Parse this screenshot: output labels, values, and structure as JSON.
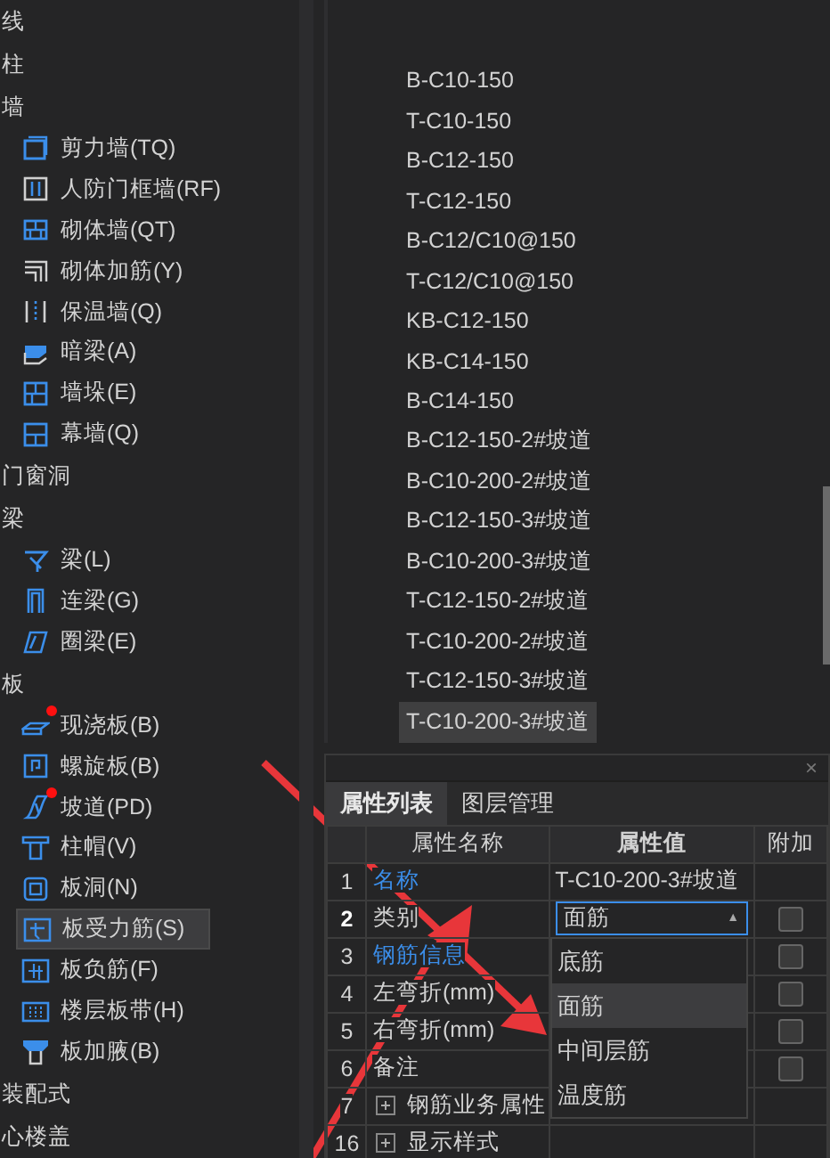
{
  "sidebar": {
    "groups": [
      {
        "label": "线"
      },
      {
        "label": "柱"
      },
      {
        "label": "墙",
        "items": [
          {
            "label": "剪力墙(TQ)",
            "selected": false,
            "badge": false
          },
          {
            "label": "人防门框墙(RF)",
            "selected": false,
            "badge": false
          },
          {
            "label": "砌体墙(QT)",
            "selected": false,
            "badge": false
          },
          {
            "label": "砌体加筋(Y)",
            "selected": false,
            "badge": false
          },
          {
            "label": "保温墙(Q)",
            "selected": false,
            "badge": false
          },
          {
            "label": "暗梁(A)",
            "selected": false,
            "badge": false
          },
          {
            "label": "墙垛(E)",
            "selected": false,
            "badge": false
          },
          {
            "label": "幕墙(Q)",
            "selected": false,
            "badge": false
          }
        ]
      },
      {
        "label": "门窗洞"
      },
      {
        "label": "梁",
        "items": [
          {
            "label": "梁(L)",
            "selected": false,
            "badge": false
          },
          {
            "label": "连梁(G)",
            "selected": false,
            "badge": false
          },
          {
            "label": "圈梁(E)",
            "selected": false,
            "badge": false
          }
        ]
      },
      {
        "label": "板",
        "items": [
          {
            "label": "现浇板(B)",
            "selected": false,
            "badge": true
          },
          {
            "label": "螺旋板(B)",
            "selected": false,
            "badge": false
          },
          {
            "label": "坡道(PD)",
            "selected": false,
            "badge": true
          },
          {
            "label": "柱帽(V)",
            "selected": false,
            "badge": false
          },
          {
            "label": "板洞(N)",
            "selected": false,
            "badge": false
          },
          {
            "label": "板受力筋(S)",
            "selected": true,
            "badge": false
          },
          {
            "label": "板负筋(F)",
            "selected": false,
            "badge": false
          },
          {
            "label": "楼层板带(H)",
            "selected": false,
            "badge": false
          },
          {
            "label": "板加腋(B)",
            "selected": false,
            "badge": false
          }
        ]
      },
      {
        "label": "装配式"
      },
      {
        "label": "心楼盖"
      }
    ]
  },
  "component_list": {
    "items": [
      {
        "label": "B-C10-150",
        "selected": false
      },
      {
        "label": "T-C10-150",
        "selected": false
      },
      {
        "label": "B-C12-150",
        "selected": false
      },
      {
        "label": "T-C12-150",
        "selected": false
      },
      {
        "label": "B-C12/C10@150",
        "selected": false
      },
      {
        "label": "T-C12/C10@150",
        "selected": false
      },
      {
        "label": "KB-C12-150",
        "selected": false
      },
      {
        "label": "KB-C14-150",
        "selected": false
      },
      {
        "label": "B-C14-150",
        "selected": false
      },
      {
        "label": "B-C12-150-2#坡道",
        "selected": false
      },
      {
        "label": "B-C10-200-2#坡道",
        "selected": false
      },
      {
        "label": "B-C12-150-3#坡道",
        "selected": false
      },
      {
        "label": "B-C10-200-3#坡道",
        "selected": false
      },
      {
        "label": "T-C12-150-2#坡道",
        "selected": false
      },
      {
        "label": "T-C10-200-2#坡道",
        "selected": false
      },
      {
        "label": "T-C12-150-3#坡道",
        "selected": false
      },
      {
        "label": "T-C10-200-3#坡道",
        "selected": true
      }
    ]
  },
  "properties": {
    "close": "×",
    "tabs": [
      {
        "label": "属性列表",
        "selected": true
      },
      {
        "label": "图层管理",
        "selected": false
      }
    ],
    "columns": [
      "属性名称",
      "属性值",
      "附加"
    ],
    "rows": [
      {
        "index": "1",
        "name": "名称",
        "kind": "link",
        "value": "T-C10-200-3#坡道",
        "current": false,
        "expandable": false
      },
      {
        "index": "2",
        "name": "类别",
        "kind": "plain",
        "value": "面筋",
        "current": true,
        "checked": false,
        "expandable": false,
        "caret": "▲"
      },
      {
        "index": "3",
        "name": "钢筋信息",
        "kind": "link",
        "current": false,
        "checked": false,
        "expandable": false
      },
      {
        "index": "4",
        "name": "左弯折(mm)",
        "kind": "plain",
        "current": false,
        "checked": false,
        "expandable": false
      },
      {
        "index": "5",
        "name": "右弯折(mm)",
        "kind": "plain",
        "current": false,
        "checked": false,
        "expandable": false
      },
      {
        "index": "6",
        "name": "备注",
        "kind": "plain",
        "current": false,
        "checked": false,
        "expandable": false
      },
      {
        "index": "7",
        "name": "钢筋业务属性",
        "kind": "plain",
        "current": false,
        "expandable": true
      },
      {
        "index": "16",
        "name": "显示样式",
        "kind": "plain",
        "current": false,
        "expandable": true
      }
    ],
    "dropdown_options": [
      {
        "label": "底筋",
        "selected": false
      },
      {
        "label": "面筋",
        "selected": true
      },
      {
        "label": "中间层筋",
        "selected": false
      },
      {
        "label": "温度筋",
        "selected": false
      }
    ]
  }
}
